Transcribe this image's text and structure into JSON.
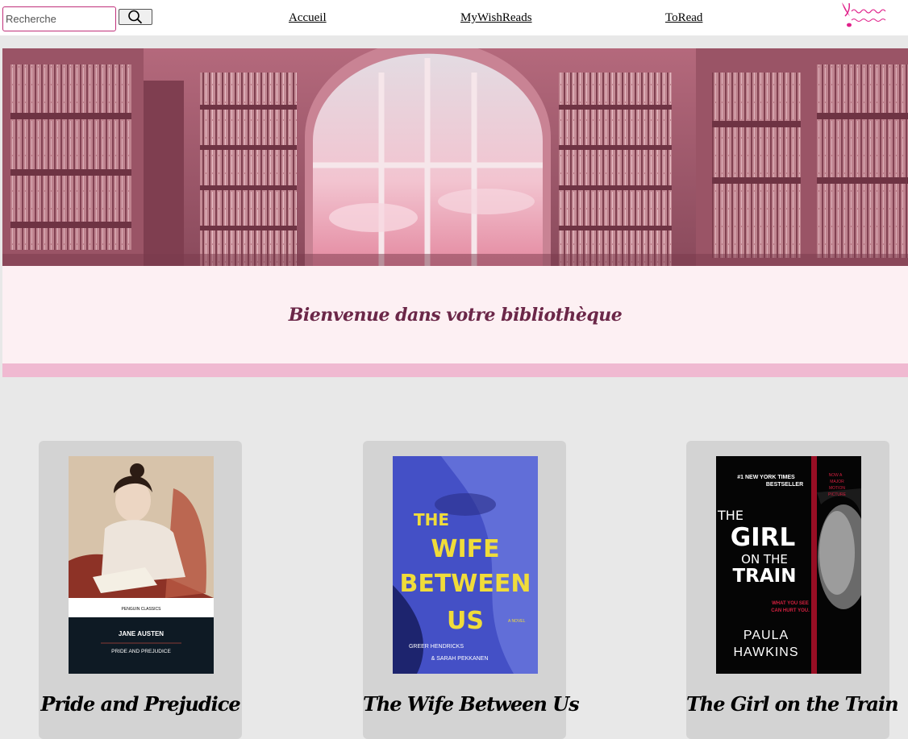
{
  "nav": {
    "search_placeholder": "Recherche",
    "links": [
      "Accueil",
      "MyWishReads",
      "ToRead"
    ]
  },
  "welcome": {
    "title": "Bienvenue dans votre bibliothèque"
  },
  "books": [
    {
      "title": "Pride and Prejudice",
      "cover_series": "PENGUIN CLASSICS",
      "cover_author": "JANE AUSTEN",
      "cover_title": "PRIDE AND PREJUDICE"
    },
    {
      "title": "The Wife Between Us",
      "cover_lines": [
        "THE",
        "WIFE",
        "BETWEEN",
        "US"
      ],
      "cover_tag": "A NOVEL",
      "cover_authors": [
        "GREER HENDRICKS",
        "& SARAH PEKKANEN"
      ]
    },
    {
      "title": "The Girl on the Train",
      "cover_bestseller_1": "#1 NEW YORK TIMES",
      "cover_bestseller_2": "BESTSELLER",
      "cover_motion": [
        "NOW A",
        "MAJOR",
        "MOTION",
        "PICTURE"
      ],
      "cover_lines": [
        "THE",
        "GIRL",
        "ON THE",
        "TRAIN"
      ],
      "cover_tagline": [
        "WHAT YOU SEE",
        "CAN HURT YOU."
      ],
      "cover_author": [
        "PAULA",
        "HAWKINS"
      ]
    }
  ],
  "colors": {
    "accent_pink": "#f0b9d1",
    "welcome_bg": "#fdf0f3",
    "welcome_text": "#6b2748",
    "search_border": "#c0307a",
    "page_bg": "#e8e8e8",
    "card_bg": "#d3d3d3"
  }
}
